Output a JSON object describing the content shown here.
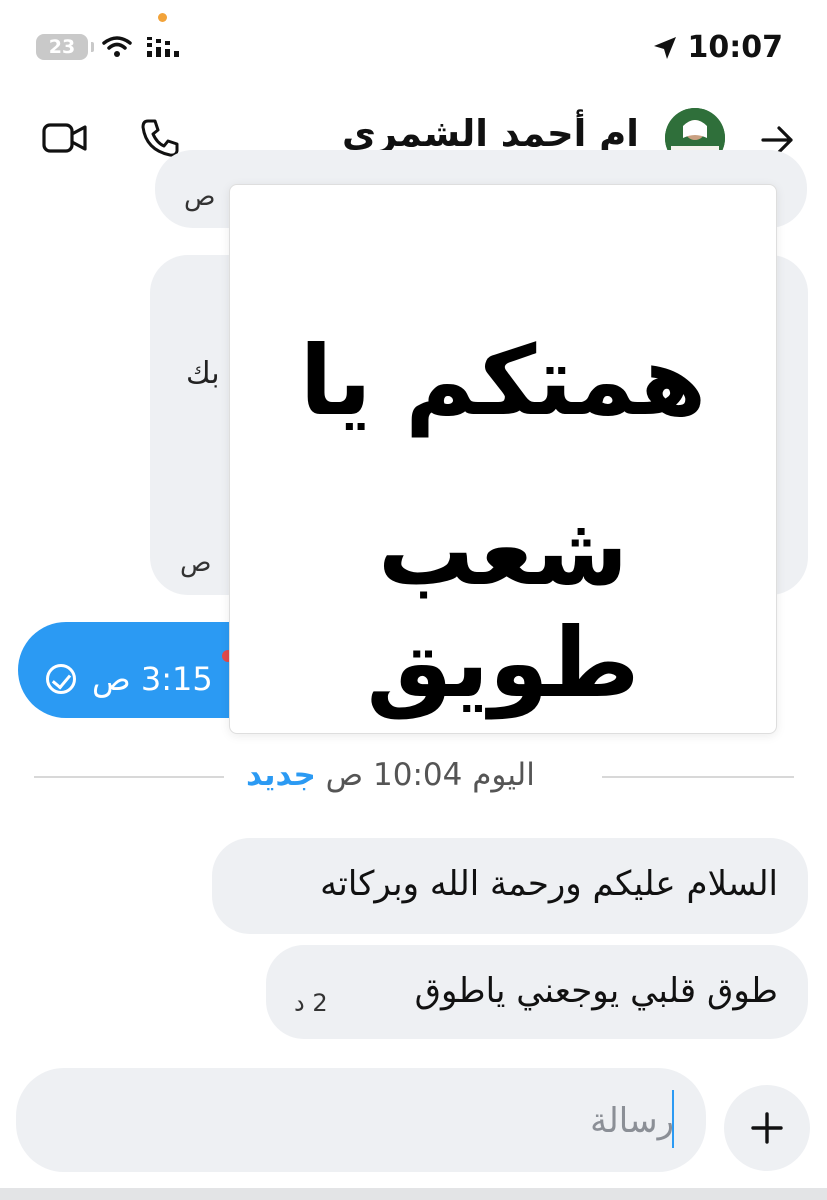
{
  "status_bar": {
    "battery_level": "23",
    "time": "10:07"
  },
  "header": {
    "contact_name": "ام أحمد الشمري"
  },
  "older_messages": {
    "bubble1_time": "ص",
    "bubble2_fragment": "بك",
    "bubble2_time": "ص"
  },
  "sent_message": {
    "time": "3:15 ص"
  },
  "sticker": {
    "line1": "همتكم يا",
    "line2": "شعب طويق"
  },
  "divider": {
    "label": "اليوم 10:04 ص",
    "new_label": "جديد"
  },
  "messages": [
    {
      "text": "السلام عليكم ورحمة الله وبركاته",
      "time": ""
    },
    {
      "text": "طوق قلبي يوجعني ياطوق",
      "time": "2 د"
    }
  ],
  "composer": {
    "placeholder": "رسالة"
  },
  "colors": {
    "accent": "#2b9af3",
    "bubble_grey": "#eef0f3",
    "notification_dot": "#f2a33a"
  }
}
